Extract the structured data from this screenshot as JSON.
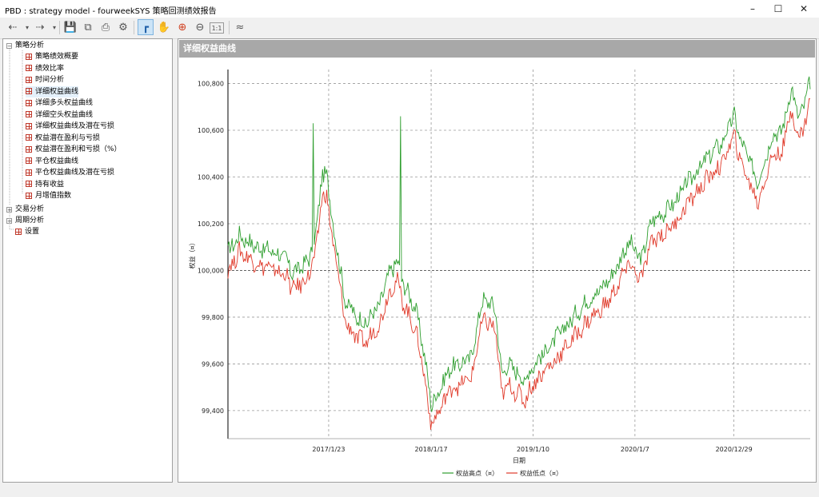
{
  "window": {
    "title": "PBD : strategy model -  fourweekSYS 策略回测绩效报告"
  },
  "tree": {
    "groups": [
      {
        "label": "策略分析",
        "expanded": true,
        "items": [
          {
            "label": "策略绩效概要"
          },
          {
            "label": "绩效比率"
          },
          {
            "label": "时间分析"
          },
          {
            "label": "详细权益曲线"
          },
          {
            "label": "详细多头权益曲线"
          },
          {
            "label": "详细空头权益曲线"
          },
          {
            "label": "详细权益曲线及潜在亏损"
          },
          {
            "label": "权益潜在盈利与亏损"
          },
          {
            "label": "权益潜在盈利和亏损（%）"
          },
          {
            "label": "平仓权益曲线"
          },
          {
            "label": "平仓权益曲线及潜在亏损"
          },
          {
            "label": "持有收益"
          },
          {
            "label": "月增值指数"
          }
        ]
      },
      {
        "label": "交易分析",
        "expanded": false
      },
      {
        "label": "周期分析",
        "expanded": false
      },
      {
        "label": "设置"
      }
    ],
    "selected": "详细权益曲线"
  },
  "panel": {
    "title": "详细权益曲线"
  },
  "chart_data": {
    "type": "line",
    "title": "",
    "xlabel": "日期",
    "ylabel": "权益（¤）",
    "ylim": [
      99280,
      100860
    ],
    "yticks": [
      "99,400",
      "99,600",
      "99,800",
      "100,000",
      "100,200",
      "100,400",
      "100,600",
      "100,800"
    ],
    "ytick_values": [
      99400,
      99600,
      99800,
      100000,
      100200,
      100400,
      100600,
      100800
    ],
    "xticks": [
      "2017/1/23",
      "2018/1/17",
      "2019/1/10",
      "2020/1/7",
      "2020/12/29"
    ],
    "grid": true,
    "legend_position": "bottom",
    "series": [
      {
        "name": "权益高点（¤）",
        "color": "#2e9e2e",
        "anchors": [
          [
            0,
            100080
          ],
          [
            0.02,
            100150
          ],
          [
            0.05,
            100100
          ],
          [
            0.08,
            100080
          ],
          [
            0.1,
            100050
          ],
          [
            0.11,
            99990
          ],
          [
            0.13,
            100020
          ],
          [
            0.14,
            100060
          ],
          [
            0.15,
            100140
          ],
          [
            0.16,
            100380
          ],
          [
            0.17,
            100420
          ],
          [
            0.18,
            100200
          ],
          [
            0.19,
            100060
          ],
          [
            0.2,
            99880
          ],
          [
            0.22,
            99800
          ],
          [
            0.24,
            99770
          ],
          [
            0.25,
            99830
          ],
          [
            0.26,
            99840
          ],
          [
            0.27,
            99940
          ],
          [
            0.28,
            100000
          ],
          [
            0.29,
            100040
          ],
          [
            0.3,
            99950
          ],
          [
            0.31,
            99900
          ],
          [
            0.32,
            99850
          ],
          [
            0.33,
            99750
          ],
          [
            0.34,
            99590
          ],
          [
            0.35,
            99420
          ],
          [
            0.36,
            99480
          ],
          [
            0.37,
            99520
          ],
          [
            0.38,
            99580
          ],
          [
            0.4,
            99600
          ],
          [
            0.42,
            99640
          ],
          [
            0.43,
            99800
          ],
          [
            0.44,
            99880
          ],
          [
            0.45,
            99860
          ],
          [
            0.46,
            99830
          ],
          [
            0.47,
            99550
          ],
          [
            0.48,
            99600
          ],
          [
            0.5,
            99560
          ],
          [
            0.51,
            99520
          ],
          [
            0.52,
            99580
          ],
          [
            0.54,
            99640
          ],
          [
            0.56,
            99700
          ],
          [
            0.58,
            99760
          ],
          [
            0.6,
            99820
          ],
          [
            0.62,
            99880
          ],
          [
            0.64,
            99920
          ],
          [
            0.66,
            99980
          ],
          [
            0.68,
            100080
          ],
          [
            0.69,
            100120
          ],
          [
            0.7,
            100080
          ],
          [
            0.71,
            100040
          ],
          [
            0.72,
            100150
          ],
          [
            0.73,
            100220
          ],
          [
            0.75,
            100250
          ],
          [
            0.77,
            100300
          ],
          [
            0.79,
            100380
          ],
          [
            0.81,
            100440
          ],
          [
            0.83,
            100500
          ],
          [
            0.85,
            100550
          ],
          [
            0.86,
            100620
          ],
          [
            0.87,
            100660
          ],
          [
            0.88,
            100560
          ],
          [
            0.89,
            100500
          ],
          [
            0.9,
            100440
          ],
          [
            0.91,
            100380
          ],
          [
            0.92,
            100460
          ],
          [
            0.93,
            100540
          ],
          [
            0.94,
            100600
          ],
          [
            0.95,
            100580
          ],
          [
            0.96,
            100700
          ],
          [
            0.97,
            100780
          ],
          [
            0.98,
            100640
          ],
          [
            0.99,
            100720
          ],
          [
            1,
            100800
          ]
        ],
        "spikes": [
          [
            0.147,
            100630
          ],
          [
            0.297,
            100660
          ]
        ]
      },
      {
        "name": "权益低点（¤）",
        "color": "#e03a2a",
        "anchors": [
          [
            0,
            100000
          ],
          [
            0.02,
            100080
          ],
          [
            0.05,
            100030
          ],
          [
            0.08,
            100000
          ],
          [
            0.1,
            99980
          ],
          [
            0.11,
            99920
          ],
          [
            0.13,
            99950
          ],
          [
            0.14,
            99990
          ],
          [
            0.15,
            100060
          ],
          [
            0.16,
            100290
          ],
          [
            0.17,
            100330
          ],
          [
            0.18,
            100110
          ],
          [
            0.19,
            99980
          ],
          [
            0.2,
            99790
          ],
          [
            0.22,
            99710
          ],
          [
            0.24,
            99690
          ],
          [
            0.25,
            99750
          ],
          [
            0.26,
            99760
          ],
          [
            0.27,
            99860
          ],
          [
            0.28,
            99920
          ],
          [
            0.29,
            99960
          ],
          [
            0.3,
            99870
          ],
          [
            0.31,
            99810
          ],
          [
            0.32,
            99760
          ],
          [
            0.33,
            99660
          ],
          [
            0.34,
            99500
          ],
          [
            0.35,
            99330
          ],
          [
            0.36,
            99390
          ],
          [
            0.37,
            99430
          ],
          [
            0.38,
            99490
          ],
          [
            0.4,
            99510
          ],
          [
            0.42,
            99550
          ],
          [
            0.43,
            99710
          ],
          [
            0.44,
            99790
          ],
          [
            0.45,
            99770
          ],
          [
            0.46,
            99740
          ],
          [
            0.47,
            99460
          ],
          [
            0.48,
            99510
          ],
          [
            0.5,
            99470
          ],
          [
            0.51,
            99440
          ],
          [
            0.52,
            99500
          ],
          [
            0.54,
            99560
          ],
          [
            0.56,
            99610
          ],
          [
            0.58,
            99670
          ],
          [
            0.6,
            99730
          ],
          [
            0.62,
            99790
          ],
          [
            0.64,
            99830
          ],
          [
            0.66,
            99890
          ],
          [
            0.68,
            99990
          ],
          [
            0.69,
            100030
          ],
          [
            0.7,
            99990
          ],
          [
            0.71,
            99960
          ],
          [
            0.72,
            100060
          ],
          [
            0.73,
            100130
          ],
          [
            0.75,
            100160
          ],
          [
            0.77,
            100210
          ],
          [
            0.79,
            100290
          ],
          [
            0.81,
            100350
          ],
          [
            0.83,
            100410
          ],
          [
            0.85,
            100460
          ],
          [
            0.86,
            100530
          ],
          [
            0.87,
            100570
          ],
          [
            0.88,
            100470
          ],
          [
            0.89,
            100410
          ],
          [
            0.9,
            100350
          ],
          [
            0.91,
            100290
          ],
          [
            0.92,
            100370
          ],
          [
            0.93,
            100450
          ],
          [
            0.94,
            100510
          ],
          [
            0.95,
            100490
          ],
          [
            0.96,
            100610
          ],
          [
            0.97,
            100690
          ],
          [
            0.98,
            100550
          ],
          [
            0.99,
            100630
          ],
          [
            1,
            100720
          ]
        ],
        "spikes": []
      }
    ]
  }
}
